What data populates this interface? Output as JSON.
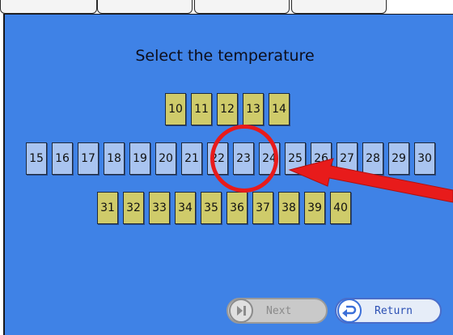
{
  "title": "Select the temperature",
  "keys_top": [
    "10",
    "11",
    "12",
    "13",
    "14"
  ],
  "keys_middle": [
    "15",
    "16",
    "17",
    "18",
    "19",
    "20",
    "21",
    "22",
    "23",
    "24",
    "25",
    "26",
    "27",
    "28",
    "29",
    "30"
  ],
  "keys_bottom": [
    "31",
    "32",
    "33",
    "34",
    "35",
    "36",
    "37",
    "38",
    "39",
    "40"
  ],
  "buttons": {
    "next_label": "Next",
    "return_label": "Return"
  },
  "annotation": {
    "highlighted_keys": [
      "22",
      "23",
      "24"
    ],
    "color": "#e81b1b"
  },
  "colors": {
    "panel": "#3f82e6",
    "key_yellow": "#cfcb6a",
    "key_blue": "#a9c4f0"
  }
}
